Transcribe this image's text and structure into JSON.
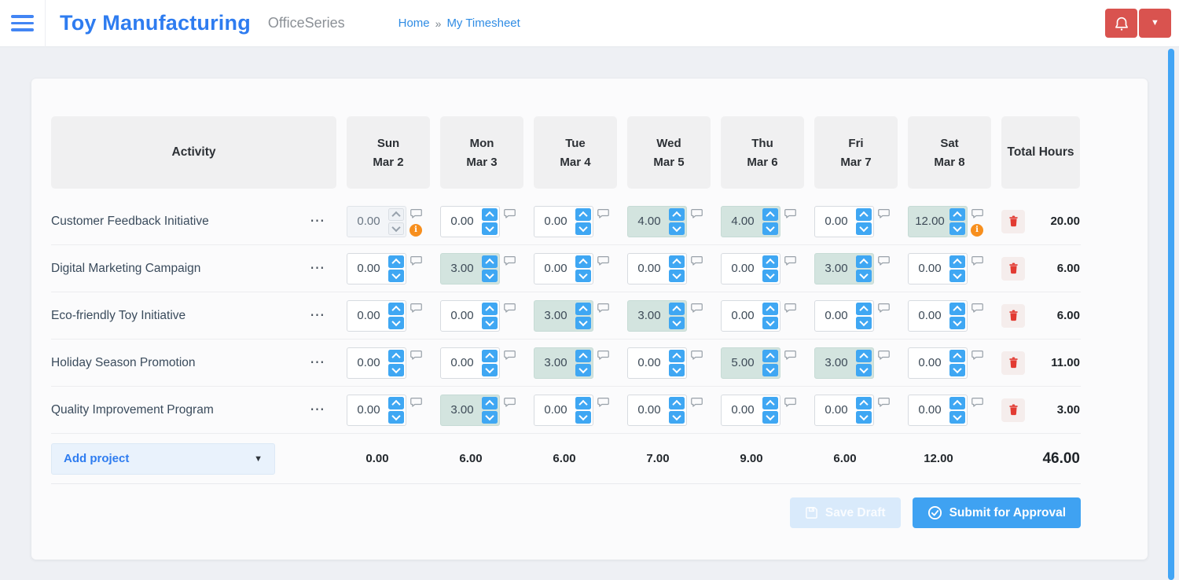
{
  "header": {
    "app_title": "Toy Manufacturing",
    "suite": "OfficeSeries",
    "breadcrumb": {
      "home": "Home",
      "sep": "»",
      "current": "My Timesheet"
    }
  },
  "icons": {
    "ellipsis": "⋯",
    "dropdown_caret": "▼",
    "warning_letter": "i"
  },
  "table": {
    "activity_header": "Activity",
    "total_hours_header": "Total Hours",
    "days": [
      {
        "weekday": "Sun",
        "date": "Mar 2"
      },
      {
        "weekday": "Mon",
        "date": "Mar 3"
      },
      {
        "weekday": "Tue",
        "date": "Mar 4"
      },
      {
        "weekday": "Wed",
        "date": "Mar 5"
      },
      {
        "weekday": "Thu",
        "date": "Mar 6"
      },
      {
        "weekday": "Fri",
        "date": "Mar 7"
      },
      {
        "weekday": "Sat",
        "date": "Mar 8"
      }
    ],
    "rows": [
      {
        "activity": "Customer Feedback Initiative",
        "cells": [
          {
            "value": "0.00",
            "disabled": true,
            "warning": true
          },
          {
            "value": "0.00"
          },
          {
            "value": "0.00"
          },
          {
            "value": "4.00",
            "filled": true
          },
          {
            "value": "4.00",
            "filled": true
          },
          {
            "value": "0.00"
          },
          {
            "value": "12.00",
            "filled": true,
            "warning": true
          }
        ],
        "total": "20.00"
      },
      {
        "activity": "Digital Marketing Campaign",
        "cells": [
          {
            "value": "0.00"
          },
          {
            "value": "3.00",
            "filled": true
          },
          {
            "value": "0.00"
          },
          {
            "value": "0.00"
          },
          {
            "value": "0.00"
          },
          {
            "value": "3.00",
            "filled": true
          },
          {
            "value": "0.00"
          }
        ],
        "total": "6.00"
      },
      {
        "activity": "Eco-friendly Toy Initiative",
        "cells": [
          {
            "value": "0.00"
          },
          {
            "value": "0.00"
          },
          {
            "value": "3.00",
            "filled": true
          },
          {
            "value": "3.00",
            "filled": true
          },
          {
            "value": "0.00"
          },
          {
            "value": "0.00"
          },
          {
            "value": "0.00"
          }
        ],
        "total": "6.00"
      },
      {
        "activity": "Holiday Season Promotion",
        "cells": [
          {
            "value": "0.00"
          },
          {
            "value": "0.00"
          },
          {
            "value": "3.00",
            "filled": true
          },
          {
            "value": "0.00"
          },
          {
            "value": "5.00",
            "filled": true
          },
          {
            "value": "3.00",
            "filled": true
          },
          {
            "value": "0.00"
          }
        ],
        "total": "11.00"
      },
      {
        "activity": "Quality Improvement Program",
        "cells": [
          {
            "value": "0.00"
          },
          {
            "value": "3.00",
            "filled": true
          },
          {
            "value": "0.00"
          },
          {
            "value": "0.00"
          },
          {
            "value": "0.00"
          },
          {
            "value": "0.00"
          },
          {
            "value": "0.00"
          }
        ],
        "total": "3.00"
      }
    ],
    "footer": {
      "add_project_label": "Add project",
      "day_totals": [
        "0.00",
        "6.00",
        "6.00",
        "7.00",
        "9.00",
        "6.00",
        "12.00"
      ],
      "grand_total": "46.00"
    }
  },
  "actions": {
    "save_draft_label": "Save Draft",
    "submit_label": "Submit for Approval"
  },
  "colors": {
    "accent_blue": "#2e7cf0",
    "spinner_blue": "#3fa7f3",
    "danger_red": "#d9534f",
    "filled_cell": "#d3e4df",
    "warning_orange": "#f78f1e",
    "scrollbar_blue": "#42a5f5"
  }
}
